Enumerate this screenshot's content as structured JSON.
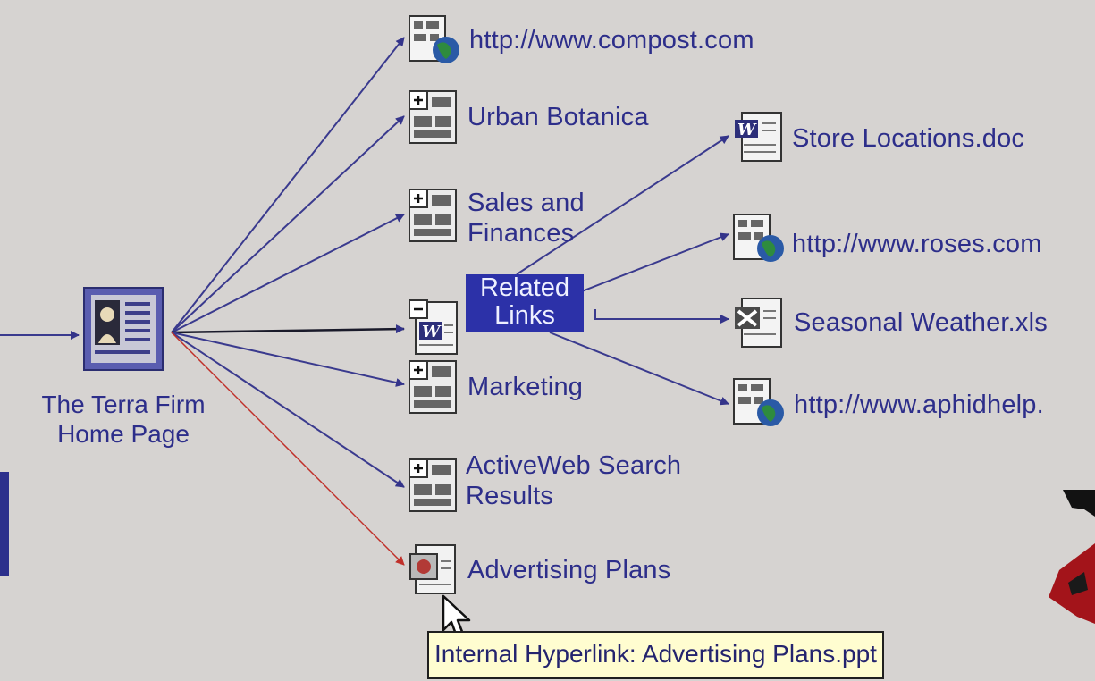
{
  "diagram": {
    "root": {
      "label_line1": "The Terra Firm",
      "label_line2": "Home Page"
    },
    "children": [
      {
        "id": "compost",
        "label": "http://www.compost.com",
        "icon": "web-globe-icon"
      },
      {
        "id": "urban",
        "label": "Urban Botanica",
        "icon": "folder-expand-icon"
      },
      {
        "id": "sales",
        "label": "Sales and Finances",
        "icon": "folder-expand-icon"
      },
      {
        "id": "related",
        "label_line1": "Related",
        "label_line2": "Links",
        "icon": "word-collapse-icon"
      },
      {
        "id": "marketing",
        "label": "Marketing",
        "icon": "folder-expand-icon"
      },
      {
        "id": "activeweb",
        "label": "ActiveWeb Search Results",
        "icon": "folder-expand-icon"
      },
      {
        "id": "advertising",
        "label": "Advertising Plans",
        "icon": "powerpoint-doc-icon"
      }
    ],
    "related_children": [
      {
        "id": "store",
        "label": "Store Locations.doc",
        "icon": "word-doc-icon"
      },
      {
        "id": "roses",
        "label": "http://www.roses.com",
        "icon": "web-globe-icon"
      },
      {
        "id": "weather",
        "label": "Seasonal Weather.xls",
        "icon": "excel-doc-icon"
      },
      {
        "id": "aphid",
        "label": "http://www.aphidhelp.",
        "icon": "web-globe-icon"
      }
    ],
    "tooltip": "Internal Hyperlink: Advertising Plans.ppt"
  },
  "colors": {
    "background": "#d6d3d1",
    "link": "#3a3a8e",
    "broken_link": "#c0302a",
    "selection": "#2c31a8",
    "tooltip_bg": "#fffdd0"
  }
}
